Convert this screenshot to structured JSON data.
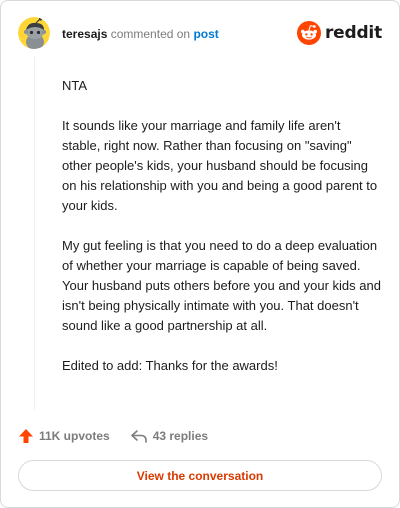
{
  "header": {
    "username": "teresajs",
    "action": "commented on",
    "target": "post",
    "logo_text": "reddit"
  },
  "comment": {
    "paragraphs": [
      "NTA",
      "It sounds like your marriage and family life aren't stable, right now. Rather than focusing on \"saving\" other people's kids, your husband should be focusing on his relationship with you and being a good parent to your kids.",
      "My gut feeling is that you need to do a deep evaluation of whether your marriage is capable of being saved. Your husband puts others before you and your kids and isn't being physically intimate with you. That doesn't sound like a good partnership at all.",
      "Edited to add: Thanks for the awards!"
    ]
  },
  "footer": {
    "upvotes": "11K upvotes",
    "replies": "43 replies"
  },
  "cta": {
    "label": "View the conversation"
  },
  "colors": {
    "brand_orange": "#ff4500",
    "link_blue": "#0079d3",
    "cta_text": "#d93a00",
    "avatar_bg": "#ffd635"
  },
  "icons": {
    "avatar": "snoo-avatar-icon",
    "logo": "reddit-alien-icon",
    "upvote": "upvote-arrow-icon",
    "reply": "reply-arrow-icon"
  }
}
